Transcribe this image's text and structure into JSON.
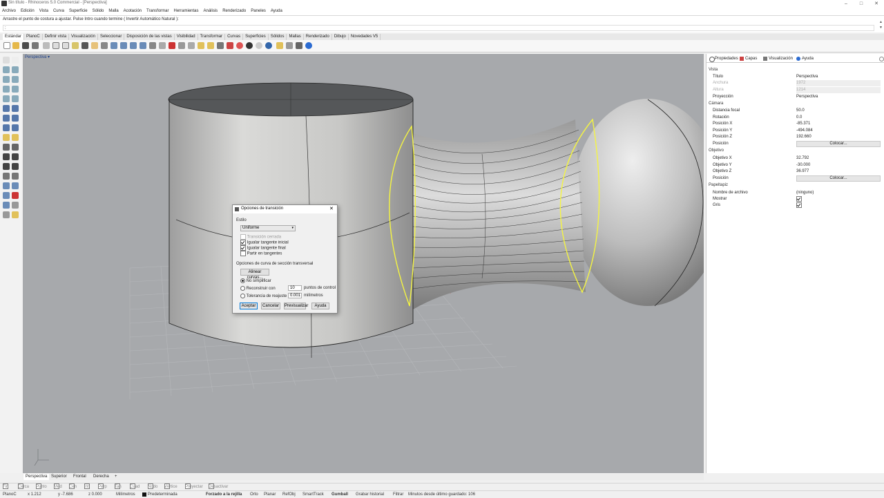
{
  "window": {
    "title": "Sin título - Rhinoceros 5.0 Commercial - [Perspectiva]",
    "controls": [
      "–",
      "□",
      "✕"
    ]
  },
  "menu": [
    "Archivo",
    "Edición",
    "Vista",
    "Curva",
    "Superficie",
    "Sólido",
    "Malla",
    "Acotación",
    "Transformar",
    "Herramientas",
    "Análisis",
    "Renderizado",
    "Paneles",
    "Ayuda"
  ],
  "command": {
    "history": "Arrastre el punto de costura a ajustar. Pulse Intro cuando termine ( Invertir  Automático  Natural ):",
    "prompt": ":"
  },
  "toolbar_tabs": [
    "Estándar",
    "PlanoC",
    "Definir vista",
    "Visualización",
    "Seleccionar",
    "Disposición de las vistas",
    "Visibilidad",
    "Transformar",
    "Curvas",
    "Superficies",
    "Sólidos",
    "Mallas",
    "Renderizado",
    "Dibujo",
    "Novedades V5"
  ],
  "viewport": {
    "label": "Perspectiva ▾",
    "tabs": [
      "Perspectiva",
      "Superior",
      "Frontal",
      "Derecha",
      "+"
    ]
  },
  "dialog": {
    "title": "Opciones de transición",
    "style_label": "Estilo",
    "style_value": "Uniforme",
    "closed_label": "Transición cerrada",
    "match_start_label": "Igualar tangente inicial",
    "match_end_label": "Igualar tangente final",
    "split_label": "Partir en tangentes",
    "section_title": "Opciones de curva de sección transversal",
    "align_button": "Alinear curvas...",
    "opt_none": "No simplificar",
    "opt_rebuild": "Reconstruir con",
    "rebuild_value": "10",
    "rebuild_unit": "puntos de control",
    "opt_tolerance": "Tolerancia de reajuste",
    "tolerance_value": "0.001",
    "tolerance_unit": "milímetros",
    "ok": "Aceptar",
    "cancel": "Cancelar",
    "preview": "Previsualizar",
    "help": "Ayuda"
  },
  "panel": {
    "tabs": [
      "Propiedades",
      "Capas",
      "Visualización",
      "Ayuda"
    ],
    "sections": [
      {
        "title": "Vista",
        "rows": [
          {
            "k": "Título",
            "v": "Perspectiva"
          },
          {
            "k": "Anchura",
            "v": "1972",
            "disabled": true
          },
          {
            "k": "Altura",
            "v": "1214",
            "disabled": true
          },
          {
            "k": "Proyección",
            "v": "Perspectiva"
          }
        ]
      },
      {
        "title": "Cámara",
        "rows": [
          {
            "k": "Distancia focal",
            "v": "50.0"
          },
          {
            "k": "Rotación",
            "v": "0.0"
          },
          {
            "k": "Posición X",
            "v": "-85.371"
          },
          {
            "k": "Posición Y",
            "v": "-494.084"
          },
          {
            "k": "Posición Z",
            "v": "192.660"
          },
          {
            "k": "Posición",
            "v": "Colocar...",
            "button": true
          }
        ]
      },
      {
        "title": "Objetivo",
        "rows": [
          {
            "k": "Objetivo X",
            "v": "32.792"
          },
          {
            "k": "Objetivo Y",
            "v": "-30.000"
          },
          {
            "k": "Objetivo Z",
            "v": "36.977"
          },
          {
            "k": "Posición",
            "v": "Colocar...",
            "button": true
          }
        ]
      },
      {
        "title": "Papeltapiz",
        "rows": [
          {
            "k": "Nombre de archivo",
            "v": "(ninguno)"
          },
          {
            "k": "Mostrar",
            "v": "",
            "checkbox": true
          },
          {
            "k": "Gris",
            "v": "",
            "checkbox": true
          }
        ]
      }
    ]
  },
  "osnaps": [
    "Fin",
    "Cerca",
    "Punto",
    "Med",
    "Cen",
    "Int",
    "Perp",
    "Tan",
    "Cuad",
    "Nodo",
    "Vértice",
    "Proyectar",
    "Desactivar"
  ],
  "status": {
    "plane": "PlanoC",
    "x": "x 1.212",
    "y": "y -7.686",
    "z": "z 0.000",
    "units": "Milímetros",
    "layer": "Predeterminada",
    "grid_snap": "Forzado a la rejilla",
    "ortho": "Orto",
    "planar": "Planar",
    "osnap": "RefObj",
    "smarttrack": "SmartTrack",
    "gumball": "Gumball",
    "history": "Grabar historial",
    "filter": "Filtrar",
    "saved": "Minutos desde último guardado: 106"
  },
  "colors": {
    "viewport_bg": "#a7a9ac",
    "selection": "#f5f542",
    "surface": "#c8c8c8"
  }
}
